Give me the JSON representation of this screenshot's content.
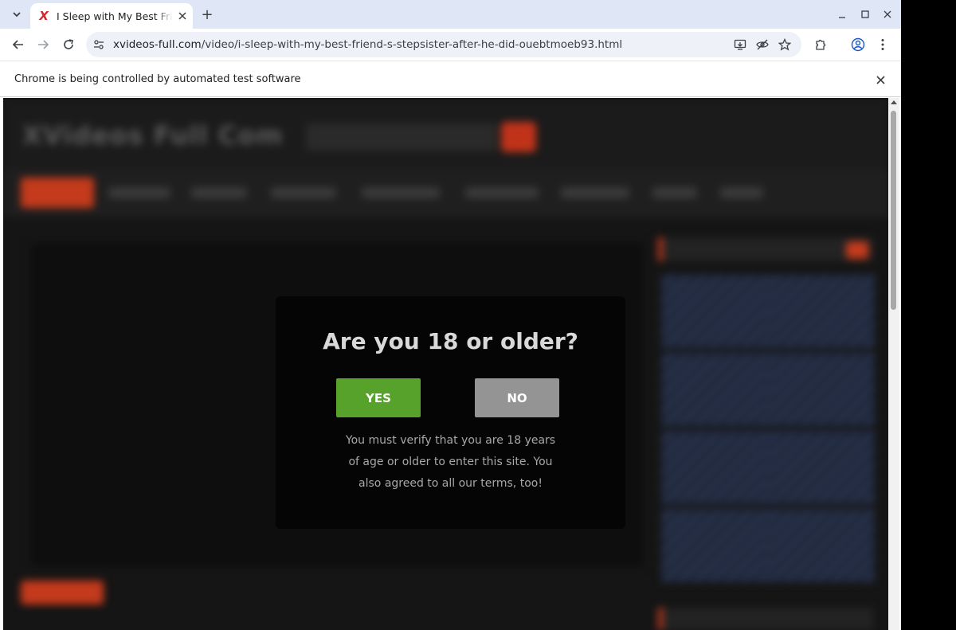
{
  "browser": {
    "tab": {
      "title": "I Sleep with My Best Friend's Stepsister After He Did",
      "favicon_letter": "X"
    },
    "new_tab_symbol": "+",
    "url": {
      "host": "xvideos-full.com",
      "path": "/video/i-sleep-with-my-best-friend-s-stepsister-after-he-did-ouebtmoeb93.html"
    },
    "infobar": {
      "text": "Chrome is being controlled by automated test software"
    },
    "icons": [
      "tab-search-icon",
      "back-icon",
      "forward-icon",
      "reload-icon",
      "site-info-icon",
      "install-app-icon",
      "eye-off-icon",
      "star-icon",
      "extensions-icon",
      "profile-icon",
      "more-icon",
      "minimize-icon",
      "maximize-icon",
      "close-icon"
    ],
    "colors": {
      "tabstrip": "#dfe6f6",
      "omnibox": "#eef1f8"
    }
  },
  "site_background": {
    "logo": "XVideos Full Com",
    "colors": {
      "accent": "#c43a1c",
      "background": "#151515"
    }
  },
  "modal": {
    "title": "Are you 18 or older?",
    "yes_label": "YES",
    "no_label": "NO",
    "message": "You must verify that you are 18 years of age or older to enter this site. You also agreed to all our terms, too!",
    "colors": {
      "yes": "#56a22a",
      "no": "#949494",
      "panel": "#050505"
    }
  }
}
